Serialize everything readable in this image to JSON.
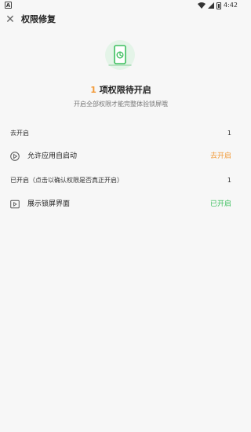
{
  "status_bar": {
    "left_icon": "A",
    "time": "4:42"
  },
  "header": {
    "title": "权限修复",
    "close_icon": "close-icon"
  },
  "hero": {
    "icon": "phone-shield-icon",
    "count": "1",
    "title_suffix": " 项权限待开启",
    "subtitle": "开启全部权限才能完整体验锁屏哦"
  },
  "pending_section": {
    "label": "去开启",
    "count": "1"
  },
  "pending_items": [
    {
      "label": "允许应用自启动",
      "action": "去开启",
      "action_color": "#f29a38",
      "icon": "autostart-icon"
    }
  ],
  "enabled_section": {
    "label": "已开启（点击以确认权限是否真正开启）",
    "count": "1"
  },
  "enabled_items": [
    {
      "label": "展示锁屏界面",
      "action": "已开启",
      "action_color": "#3cbf5e",
      "icon": "lockscreen-display-icon"
    }
  ]
}
